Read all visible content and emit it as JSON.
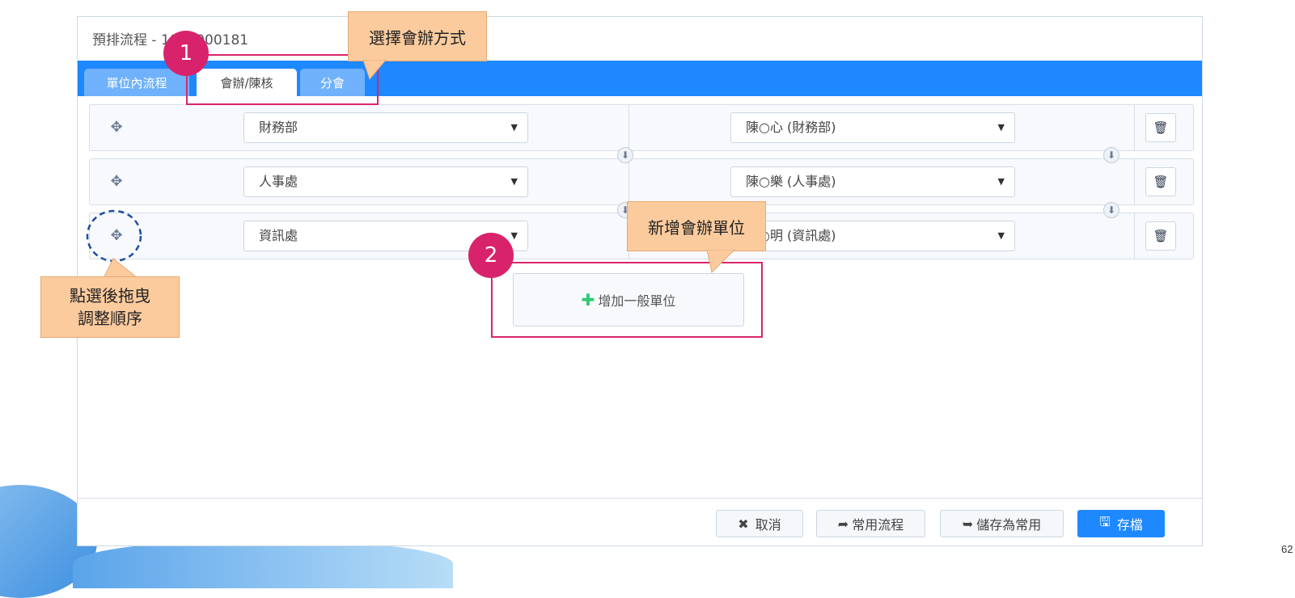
{
  "page_number": "62",
  "window": {
    "title": "預排流程 - 1090000181"
  },
  "tabs": [
    {
      "label": "單位內流程",
      "active": false
    },
    {
      "label": "會辦/陳核",
      "active": true
    },
    {
      "label": "分會",
      "active": false
    }
  ],
  "rows": [
    {
      "department": "財務部",
      "person": "陳○心 (財務部)"
    },
    {
      "department": "人事處",
      "person": "陳○樂 (人事處)"
    },
    {
      "department": "資訊處",
      "person": "陳○明 (資訊處)"
    }
  ],
  "add_unit": {
    "plus": "✚",
    "label": "增加一般單位"
  },
  "footer": {
    "cancel": "取消",
    "common_flow": "常用流程",
    "save_as_common": "儲存為常用",
    "save": "存檔"
  },
  "annotations": {
    "badge1": "1",
    "badge2": "2",
    "callout_method": "選擇會辦方式",
    "callout_add": "新增會辦單位",
    "callout_drag_line1": "點選後拖曳",
    "callout_drag_line2": "調整順序"
  },
  "colors": {
    "accent": "#1e88ff",
    "annotation": "#d9266a",
    "callout": "#fbcb9e",
    "add_plus": "#2ecc71"
  },
  "icons": {
    "handle": "move-icon",
    "delete": "trash-icon",
    "arrow": "arrow-down-icon"
  }
}
